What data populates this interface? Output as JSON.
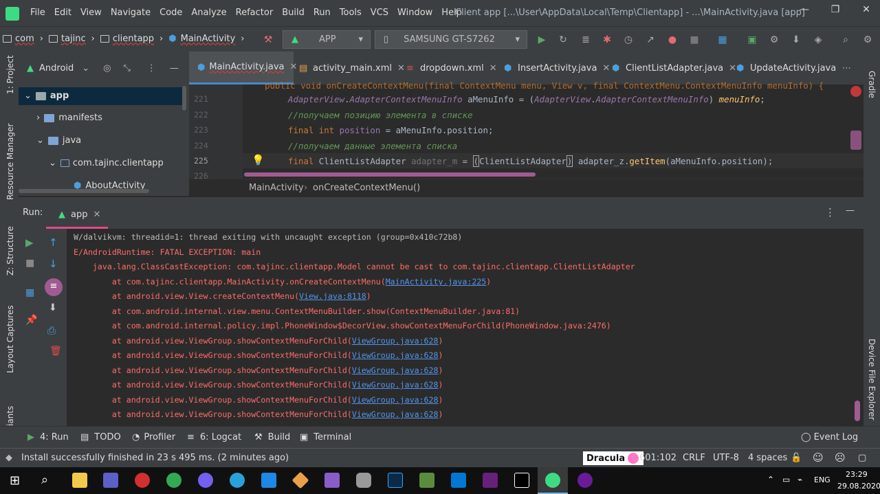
{
  "menubar": {
    "items": [
      "File",
      "Edit",
      "View",
      "Navigate",
      "Code",
      "Analyze",
      "Refactor",
      "Build",
      "Run",
      "Tools",
      "VCS",
      "Window",
      "Help"
    ],
    "title": "Client app [...\\User\\AppData\\Local\\Temp\\Clientapp] - ...\\MainActivity.java [app]"
  },
  "navbar": {
    "crumbs": [
      "com",
      "tajinc",
      "clientapp",
      "MainActivity"
    ],
    "config": "APP",
    "device": "SAMSUNG GT-S7262"
  },
  "sidestrip": {
    "project": "1: Project",
    "resource": "Resource Manager",
    "structure": "Z: Structure",
    "captures": "Layout Captures",
    "variants": "iants",
    "gradle": "Gradle",
    "explorer": "Device File Explorer"
  },
  "project": {
    "view": "Android",
    "tree": [
      "app",
      "manifests",
      "java",
      "com.tajinc.clientapp",
      "AboutActivity"
    ]
  },
  "tabs": [
    "MainActivity.java",
    "activity_main.xml",
    "dropdown.xml",
    "InsertActivity.java",
    "ClientListAdapter.java",
    "UpdateActivity.java"
  ],
  "editor": {
    "lines": [
      "221",
      "222",
      "223",
      "224",
      "225",
      "226"
    ],
    "line0": "public void onCreateContextMenu(final ContextMenu menu, View v, final ContextMenu.ContextMenuInfo menuInfo) {",
    "c221a": "AdapterView",
    ".c221b": "",
    "c222": "//получаем позицию элемента в списке",
    "c224": "//получаем данные элемента списка",
    "crumb_class": "MainActivity",
    "crumb_method": "onCreateContextMenu()"
  },
  "run": {
    "label": "Run:",
    "tab": "app"
  },
  "console": {
    "l1": "W/dalvikvm: threadid=1: thread exiting with uncaught exception (group=0x410c72b8)",
    "l2": "E/AndroidRuntime: FATAL EXCEPTION: main",
    "l3": "    java.lang.ClassCastException: com.tajinc.clientapp.Model cannot be cast to com.tajinc.clientapp.ClientListAdapter",
    "l4a": "        at com.tajinc.clientapp.MainActivity.onCreateContextMenu(",
    "l4b": "MainActivity.java:225",
    "l4c": ")",
    "l5a": "        at android.view.View.createContextMenu(",
    "l5b": "View.java:8118",
    "l5c": ")",
    "l6": "        at com.android.internal.view.menu.ContextMenuBuilder.show(ContextMenuBuilder.java:81)",
    "l7": "        at com.android.internal.policy.impl.PhoneWindow$DecorView.showContextMenuForChild(PhoneWindow.java:2476)",
    "vg_a": "        at android.view.ViewGroup.showContextMenuForChild(",
    "vg_b": "ViewGroup.java:628",
    "vg_c": ")"
  },
  "bottomtabs": [
    "4: Run",
    "TODO",
    "Profiler",
    "6: Logcat",
    "Build",
    "Terminal",
    "Event Log"
  ],
  "status": {
    "message": "Install successfully finished in 23 s 495 ms. (2 minutes ago)",
    "theme": "Dracula",
    "pos": "601:102",
    "eol": "CRLF",
    "enc": "UTF-8",
    "indent": "4 spaces"
  },
  "taskbar": {
    "lang": "ENG",
    "time": "23:29",
    "date": "29.08.2020"
  }
}
